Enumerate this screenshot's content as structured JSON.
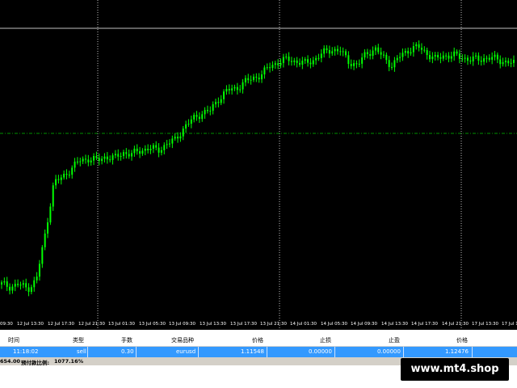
{
  "chart_data": {
    "type": "candlestick",
    "x_tick_labels": [
      "09:30",
      "12 Jul 13:30",
      "12 Jul 17:30",
      "12 Jul 21:30",
      "13 Jul 01:30",
      "13 Jul 05:30",
      "13 Jul 09:30",
      "13 Jul 13:30",
      "13 Jul 17:30",
      "13 Jul 21:30",
      "14 Jul 01:30",
      "14 Jul 05:30",
      "14 Jul 09:30",
      "14 Jul 13:30",
      "14 Jul 17:30",
      "14 Jul 21:30",
      "17 Jul 13:30",
      "17 Jul 17:30"
    ],
    "series_close": [
      0.06,
      0.05,
      0.06,
      0.04,
      0.08,
      0.3,
      0.55,
      0.58,
      0.62,
      0.66,
      0.67,
      0.66,
      0.68,
      0.67,
      0.7,
      0.69,
      0.71,
      0.72,
      0.71,
      0.74,
      0.76,
      0.82,
      0.86,
      0.89,
      0.9,
      0.96,
      1.0,
      1.01,
      1.04,
      1.06,
      1.08,
      1.12,
      1.14,
      1.15,
      1.14,
      1.13,
      1.15,
      1.18,
      1.2,
      1.19,
      1.14,
      1.12,
      1.18,
      1.2,
      1.16,
      1.12,
      1.17,
      1.2,
      1.21,
      1.18,
      1.15,
      1.17,
      1.17,
      1.16,
      1.15,
      1.15,
      1.16,
      1.15,
      1.14,
      1.13
    ],
    "grid_lines_horizontal": [
      1.154
    ],
    "grid_lines_vertical_labels": [
      "12 Jul 21:30",
      "13 Jul 21:30",
      "14 Jul 21:30"
    ]
  },
  "colors": {
    "background": "#000000",
    "candle": "#00ff00",
    "grid": "#c0c0c0",
    "order_row": "#3399ff",
    "balance_bar": "#d4d0c8"
  },
  "terminal": {
    "headers": [
      "时间",
      "类型",
      "手数",
      "交易品种",
      "价格",
      "止损",
      "止盈",
      "价格"
    ],
    "row": [
      "11:18:02",
      "sell",
      "0.30",
      "eurusd",
      "1.11548",
      "0.00000",
      "0.00000",
      "1.12476"
    ],
    "balance_value": "654.00",
    "margin_label": "预付款比例:",
    "margin_value": "1077.16%"
  },
  "watermark": "www.mt4.shop"
}
